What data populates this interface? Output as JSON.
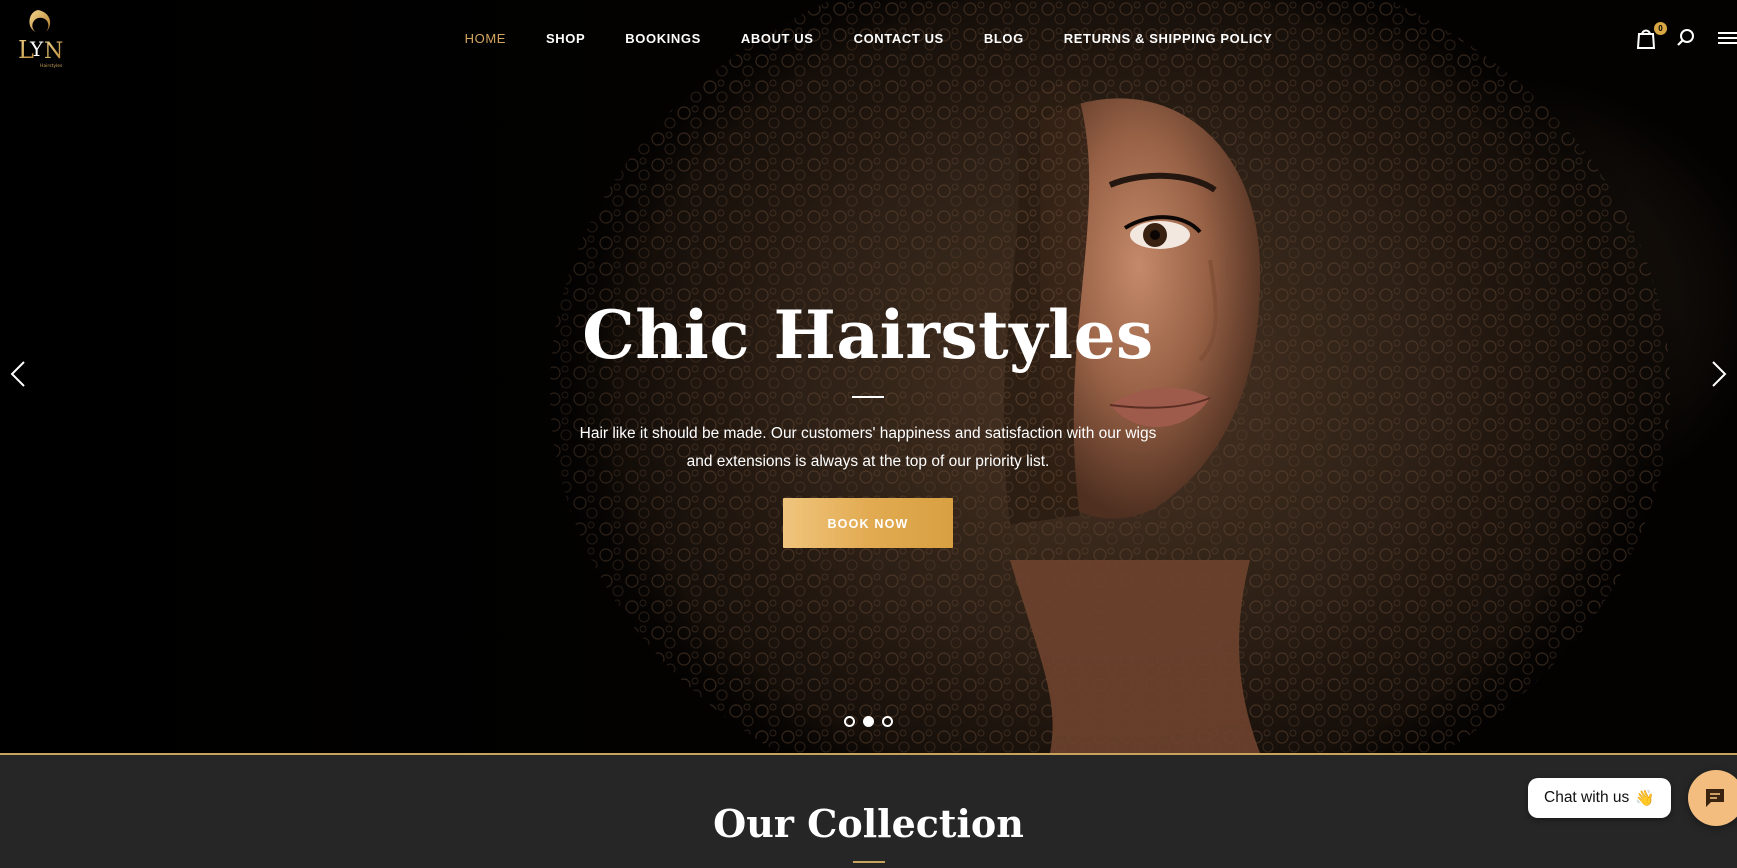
{
  "header": {
    "logo_text": "LYN",
    "logo_subtext": "Hairstyles",
    "cart_count": "0",
    "icons": [
      "shopping-bag-icon",
      "search-icon",
      "menu-icon"
    ]
  },
  "nav": {
    "items": [
      {
        "label": "HOME",
        "active": true
      },
      {
        "label": "SHOP",
        "active": false
      },
      {
        "label": "BOOKINGS",
        "active": false
      },
      {
        "label": "ABOUT US",
        "active": false
      },
      {
        "label": "CONTACT US",
        "active": false
      },
      {
        "label": "BLOG",
        "active": false
      },
      {
        "label": "RETURNS & SHIPPING POLICY",
        "active": false
      }
    ]
  },
  "hero": {
    "title": "Chic Hairstyles",
    "text": "Hair like it should be made. Our customers' happiness and satisfaction with our wigs and extensions is always at the top of our priority list.",
    "button_label": "BOOK NOW",
    "slide_count": 3,
    "active_slide": 2
  },
  "collection": {
    "title": "Our Collection"
  },
  "chat": {
    "bubble_text": "Chat with us",
    "bubble_emoji": "👋"
  },
  "colors": {
    "accent_gold": "#d3a760",
    "button_gold": "#e2ab52",
    "chat_launcher": "#f2bd7f",
    "section_bg": "#262626"
  }
}
